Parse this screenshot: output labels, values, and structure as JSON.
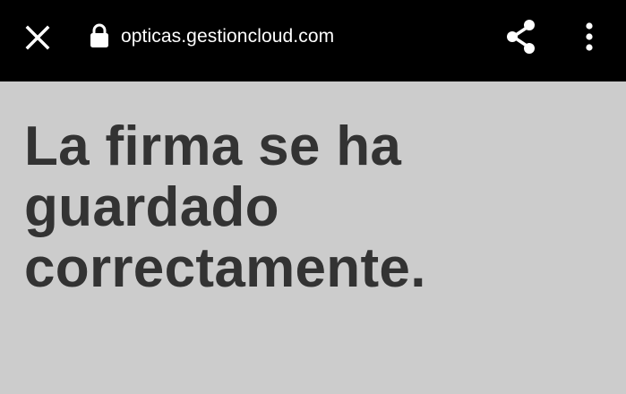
{
  "browser": {
    "url": "opticas.gestioncloud.com",
    "icons": {
      "close": "close-icon",
      "lock": "lock-icon",
      "share": "share-icon",
      "menu": "more-vert-icon"
    },
    "bar_color": "#000000"
  },
  "page": {
    "message": "La firma se ha guardado correctamente.",
    "background_color": "#cccccc",
    "text_color": "#333333"
  }
}
